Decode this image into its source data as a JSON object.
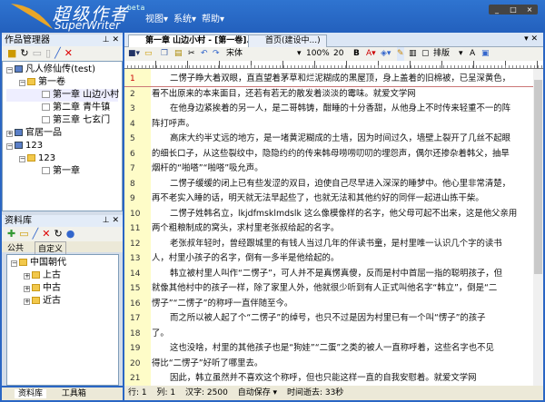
{
  "app": {
    "logo_cn": "超级作者",
    "logo_en": "SuperWriter",
    "beta": "beta",
    "menu": [
      "视图▾",
      "系统▾",
      "帮助▾"
    ],
    "window_buttons": [
      "_",
      "□",
      "×"
    ]
  },
  "works_panel": {
    "title": "作品管理器",
    "tree": [
      {
        "label": "凡人修仙传(test)",
        "level": 0,
        "type": "book",
        "exp": "−"
      },
      {
        "label": "第一卷",
        "level": 1,
        "type": "folder",
        "exp": "−"
      },
      {
        "label": "第一章 山边小村",
        "level": 2,
        "type": "doc",
        "selected": true
      },
      {
        "label": "第二章 青牛镇",
        "level": 2,
        "type": "doc"
      },
      {
        "label": "第三章 七玄门",
        "level": 2,
        "type": "doc"
      },
      {
        "label": "官居一品",
        "level": 0,
        "type": "book",
        "exp": "+"
      },
      {
        "label": "123",
        "level": 0,
        "type": "book",
        "exp": "−"
      },
      {
        "label": "123",
        "level": 1,
        "type": "folder",
        "exp": "−"
      },
      {
        "label": "第一章",
        "level": 2,
        "type": "doc"
      }
    ]
  },
  "library_panel": {
    "title": "资料库",
    "tabs": [
      "公共",
      "自定义"
    ],
    "tree": [
      {
        "label": "中国朝代",
        "level": 0,
        "exp": "−"
      },
      {
        "label": "上古",
        "level": 1,
        "exp": "+"
      },
      {
        "label": "中古",
        "level": 1,
        "exp": "+"
      },
      {
        "label": "近古",
        "level": 1,
        "exp": "+"
      }
    ]
  },
  "bottom_tabs": [
    "资料库",
    "工具箱"
  ],
  "doc_tabs": [
    "第一章 山边小村 - [第一卷]...",
    "首页(建设中...)"
  ],
  "toolbar": {
    "font": "宋体",
    "zoom": "100%",
    "line_spacing": "20",
    "bold": "B",
    "layout": "排版"
  },
  "lines": [
    {
      "n": "1",
      "t": "二愣子睁大着双眼，直直望着茅草和烂泥糊成的黑屋顶，身上盖着的旧棉被，已呈深黄色，",
      "ind": true
    },
    {
      "n": "2",
      "t": "看不出原来的本来面目，还若有若无的散发着淡淡的霉味。就爱文学网",
      "ind": false
    },
    {
      "n": "3",
      "t": "在他身边紧挨着的另一人，是二哥韩铸，酣睡的十分香甜，从他身上不时传来轻重不一的阵",
      "ind": true
    },
    {
      "n": "4",
      "t": "阵打呼声。",
      "ind": false
    },
    {
      "n": "5",
      "t": "高床大约半丈远的地方，是一堵黄泥糊成的土墙，因为时间过久，墙壁上裂开了几丝不起眼",
      "ind": true
    },
    {
      "n": "6",
      "t": "的细长口子，从这些裂纹中，隐隐约约的传来韩母唠唠叨叨的埋怨声，偶尔还掺杂着韩父，抽旱",
      "ind": false
    },
    {
      "n": "7",
      "t": "烟杆的“啪嗒”“啪嗒”吸允声。",
      "ind": false
    },
    {
      "n": "8",
      "t": "二愣子缓缓的闭上已有些发涩的双目，迫使自己尽早进入深深的睡梦中。他心里非常清楚，",
      "ind": true
    },
    {
      "n": "9",
      "t": "再不老实入睡的话，明天就无法早起些了，也就无法和其他约好的同伴一起进山拣干柴。",
      "ind": false
    },
    {
      "n": "10",
      "t": "二愣子姓韩名立，lkjdfmsklmdslk 这么像模像样的名字，他父母可起不出来，这是他父亲用",
      "ind": true
    },
    {
      "n": "11",
      "t": "两个粗粮制成的窝头，求村里老张叔给起的名字。",
      "ind": false
    },
    {
      "n": "12",
      "t": "老张叔年轻时，曾经跟城里的有钱人当过几年的伴读书童，是村里唯一认识几个字的读书",
      "ind": true
    },
    {
      "n": "13",
      "t": "人，村里小孩子的名字，倒有一多半是他给起的。",
      "ind": false
    },
    {
      "n": "14",
      "t": "韩立被村里人叫作“二愣子”，可人并不是真愣真傻，反而是村中首屈一指的聪明孩子，但",
      "ind": true
    },
    {
      "n": "15",
      "t": "就像其他村中的孩子一样，除了家里人外，他就很少听到有人正式叫他名字“韩立”，倒是“二",
      "ind": false
    },
    {
      "n": "16",
      "t": "愣子”“二愣子”的称呼一直伴随至今。",
      "ind": false
    },
    {
      "n": "17",
      "t": "而之所以被人起了个“二愣子”的绰号，也只不过是因为村里已有一个叫“愣子”的孩子",
      "ind": true
    },
    {
      "n": "18",
      "t": "了。",
      "ind": false
    },
    {
      "n": "19",
      "t": "这也没啥，村里的其他孩子也是“狗娃”“二蛋”之类的被人一直称呼着，这些名字也不见",
      "ind": true
    },
    {
      "n": "20",
      "t": "得比“二愣子”好听了哪里去。",
      "ind": false
    },
    {
      "n": "21",
      "t": "因此，韩立虽然并不喜欢这个称呼，但也只能这样一直的自我安慰着。就爱文学网",
      "ind": true
    }
  ],
  "status": {
    "row": "行: 1",
    "col": "列: 1",
    "chars": "汉字: 2500",
    "autosave": "自动保存 ▾",
    "elapsed": "时间逝去: 33秒"
  },
  "colors": {
    "frame": "#2a66c4",
    "gutter": "#fefcc8",
    "current_line_number": "#cc0000"
  }
}
